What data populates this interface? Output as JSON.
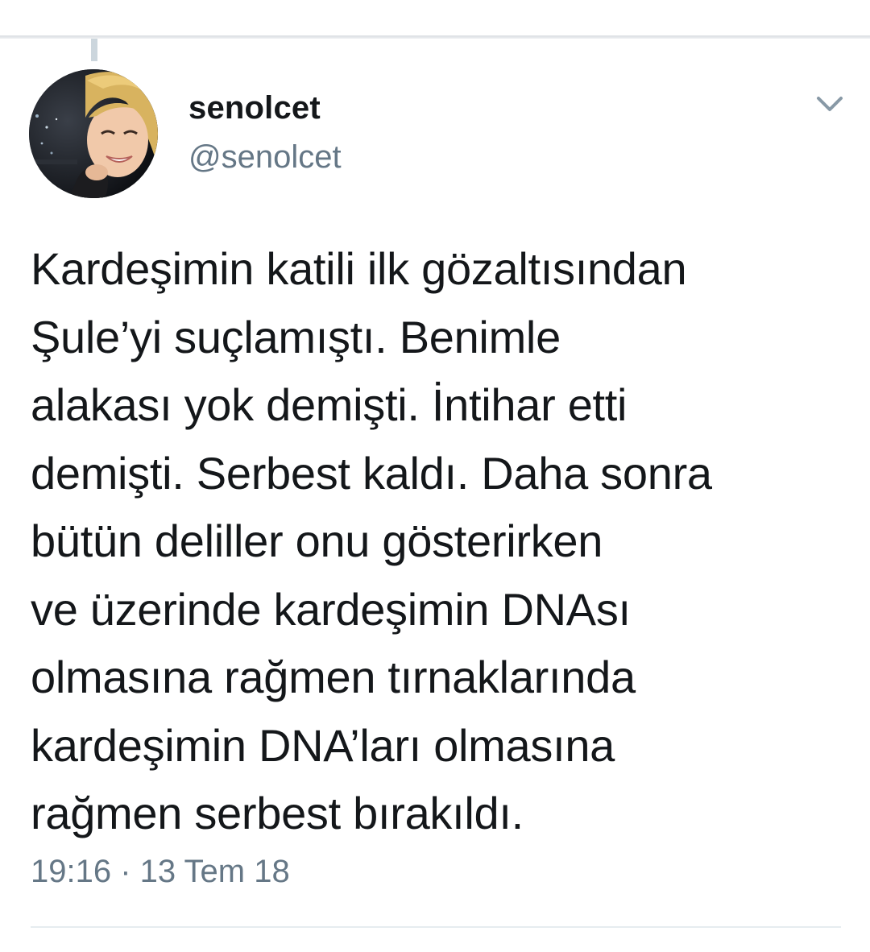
{
  "tweet": {
    "author": {
      "display_name": "senolcet",
      "handle": "@senolcet"
    },
    "text": "Kardeşimin katili ilk gözaltısından\nŞule’yi suçlamıştı. Benimle\nalakası yok demişti. İntihar etti\ndemişti. Serbest kaldı. Daha sonra\nbütün deliller onu gösterirken\nve üzerinde kardeşimin DNAsı\nolmasına rağmen tırnaklarında\nkardeşimin DNA’ları olmasına\nrağmen serbest bırakıldı.",
    "time": "19:16",
    "separator": " · ",
    "date": "13 Tem 18",
    "menu_icon": "chevron-down-icon"
  },
  "colors": {
    "text_primary": "#14171a",
    "text_secondary": "#657786",
    "divider": "#e6ecf0",
    "thread_line": "#ccd6dd"
  }
}
